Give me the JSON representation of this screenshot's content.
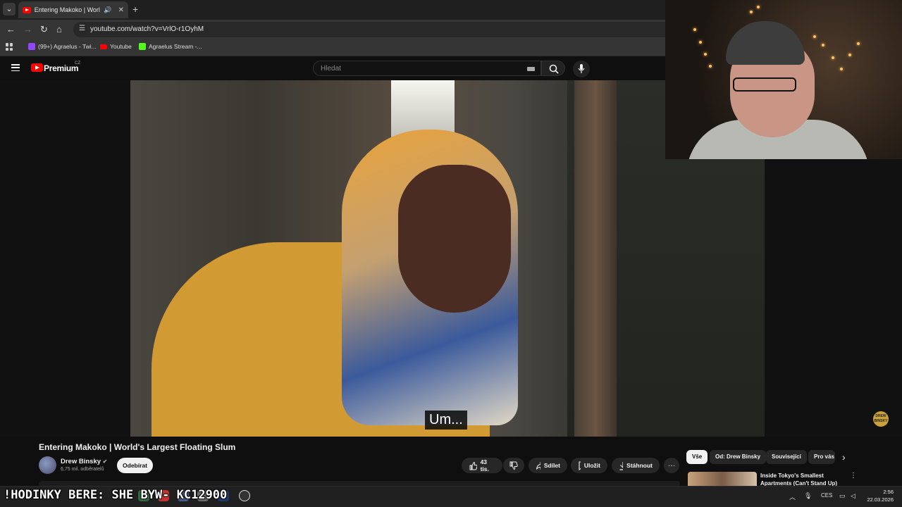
{
  "browser": {
    "tab": {
      "title": "Entering Makoko | World's",
      "audio_icon": "speaker-icon",
      "close_glyph": "✕"
    },
    "new_tab_glyph": "+",
    "url": "youtube.com/watch?v=VrlO-r1OyhM",
    "bookmarks": [
      {
        "label": "(99+) Agraelus - Twi...",
        "icon": "twitch-icon",
        "color": "#9146ff"
      },
      {
        "label": "Youtube",
        "icon": "youtube-icon",
        "color": "#ff0000"
      },
      {
        "label": "Agraelus Stream -...",
        "icon": "kick-icon",
        "color": "#53fc18"
      }
    ]
  },
  "youtube": {
    "logo_text": "Premium",
    "logo_region": "CZ",
    "search_placeholder": "Hledat"
  },
  "video": {
    "subtitle": "Um...",
    "watermark": "DREW BINSKY"
  },
  "info": {
    "title": "Entering Makoko | World's Largest Floating Slum",
    "channel_name": "Drew Binsky",
    "verified_glyph": "✔",
    "subscribers": "6,75 mil. odběratelů",
    "subscribe_label": "Odebírat",
    "likes": "43 tis.",
    "share_label": "Sdílet",
    "save_label": "Uložit",
    "download_label": "Stáhnout",
    "more_glyph": "…"
  },
  "sidebar": {
    "chips": [
      "Vše",
      "Od: Drew Binsky",
      "Související",
      "Pro vás"
    ],
    "next_glyph": "›",
    "recommended": {
      "title": "Inside Tokyo's Smallest Apartments (Can't Stand Up)"
    }
  },
  "taskbar": {
    "overlay": "!HODINKY BERE: SHE  BYW- KC12900",
    "language": "CES",
    "time": "2:56",
    "date": "22.03.2026"
  },
  "colors": {
    "accent": "#ff0000",
    "background": "#0f0f0f",
    "pill": "#272727"
  }
}
